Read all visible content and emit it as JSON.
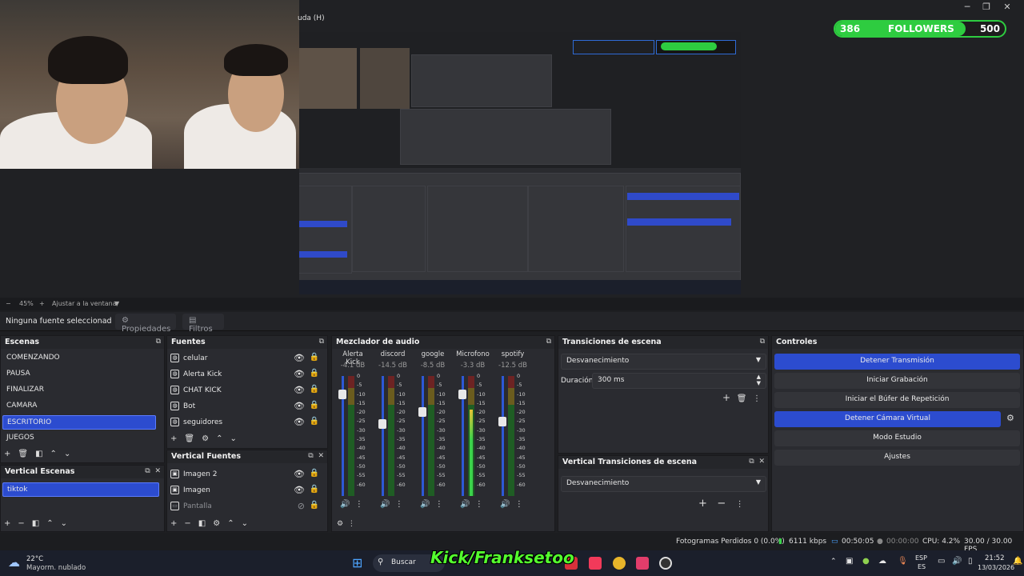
{
  "menu_fragment": "uda (H)",
  "followers": {
    "current": "386",
    "label": "FOLLOWERS",
    "goal": "500",
    "progress": 0.77
  },
  "zoom": {
    "minus": "−",
    "level": "45%",
    "plus": "+",
    "fit": "Ajustar a la ventana"
  },
  "context": {
    "no_source": "Ninguna fuente seleccionad",
    "properties": "Propiedades",
    "filters": "Filtros"
  },
  "scenes": {
    "title": "Escenas",
    "items": [
      "COMENZANDO",
      "PAUSA",
      "FINALIZAR",
      "CAMARA",
      "ESCRITORIO",
      "JUEGOS"
    ],
    "selected": "ESCRITORIO"
  },
  "vertical_scenes": {
    "title": "Vertical Escenas",
    "items": [
      "tiktok"
    ]
  },
  "sources": {
    "title": "Fuentes",
    "items": [
      "celular",
      "Alerta Kick",
      "CHAT KICK",
      "Bot",
      "seguidores"
    ]
  },
  "vertical_sources": {
    "title": "Vertical Fuentes",
    "items": [
      "Imagen 2",
      "Imagen",
      "Pantalla"
    ]
  },
  "mixer": {
    "title": "Mezclador de audio",
    "scale": [
      "0",
      "-5",
      "-10",
      "-15",
      "-20",
      "-25",
      "-30",
      "-35",
      "-40",
      "-45",
      "-50",
      "-55",
      "-60"
    ],
    "channels": [
      {
        "name": "Alerta Kick",
        "db": "-4.1 dB",
        "volume": 0.85,
        "level": 0.0
      },
      {
        "name": "discord",
        "db": "-14.5 dB",
        "volume": 0.6,
        "level": 0.0
      },
      {
        "name": "google",
        "db": "-8.5 dB",
        "volume": 0.7,
        "level": 0.0
      },
      {
        "name": "Microfono",
        "db": "-3.3 dB",
        "volume": 0.85,
        "level": 0.72
      },
      {
        "name": "spotify",
        "db": "-12.5 dB",
        "volume": 0.62,
        "level": 0.0
      }
    ]
  },
  "transitions": {
    "title": "Transiciones de escena",
    "selected": "Desvanecimiento",
    "duration_label": "Duración",
    "duration": "300 ms"
  },
  "vertical_transitions": {
    "title": "Vertical Transiciones de escena",
    "selected": "Desvanecimiento"
  },
  "controls": {
    "title": "Controles",
    "buttons": [
      "Detener Transmisión",
      "Iniciar Grabación",
      "Iniciar el Búfer de Repetición",
      "Detener Cámara Virtual",
      "Modo Estudio",
      "Ajustes"
    ]
  },
  "status": {
    "dropped": "Fotogramas Perdidos 0 (0.0%)",
    "bitrate": "6111 kbps",
    "stream_time": "00:50:05",
    "rec_time": "00:00:00",
    "cpu": "CPU: 4.2%",
    "fps": "30.00 / 30.00 FPS"
  },
  "taskbar": {
    "weather_temp": "22°C",
    "weather_desc": "Mayorm. nublado",
    "search": "Buscar",
    "lang": "ESP",
    "lang2": "ES",
    "time": "21:52",
    "date": "13/03/2026"
  },
  "overlay_text": "Kick/Franksetoo",
  "colors": {
    "accent": "#2c4ccf",
    "followers_green": "#2ecc40",
    "kick_green": "#54ff2e"
  }
}
